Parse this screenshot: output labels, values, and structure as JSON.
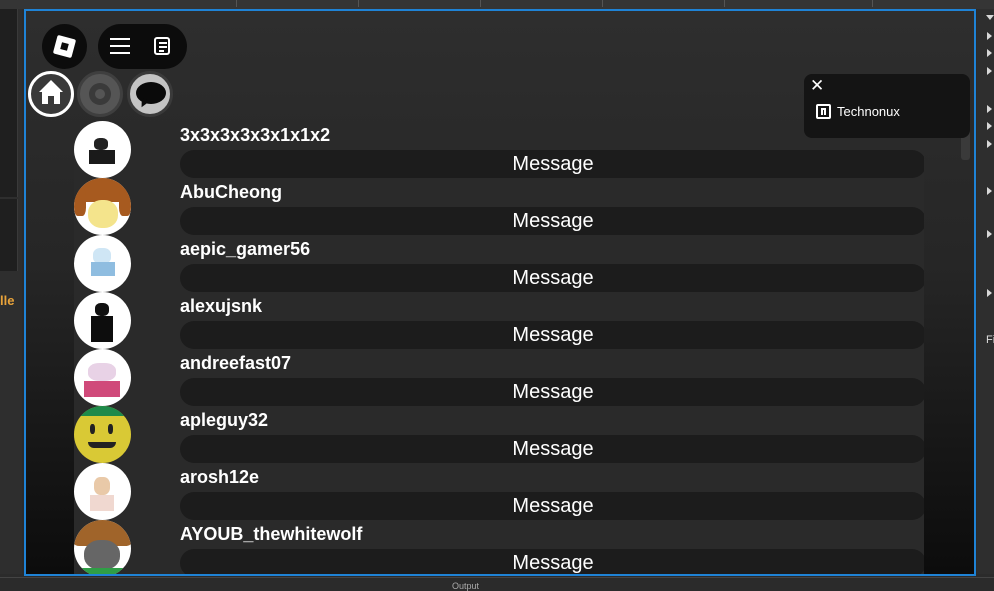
{
  "studio": {
    "left_label_fragment": "lle",
    "right_label_fragment": "Fi",
    "bottom_label_fragment": "Output"
  },
  "topbar": {
    "logo_icon": "roblox-logo-icon",
    "menu_icon": "hamburger-menu-icon",
    "chat_icon": "chat-document-icon"
  },
  "nav": {
    "home_icon": "home-icon",
    "settings_icon": "gear-icon",
    "chat_icon": "speech-bubble-icon"
  },
  "notification": {
    "close_glyph": "✕",
    "name": "Technonux"
  },
  "friends": [
    {
      "username": "3x3x3x3x3x1x1x2",
      "button": "Message"
    },
    {
      "username": "AbuCheong",
      "button": "Message"
    },
    {
      "username": "aepic_gamer56",
      "button": "Message"
    },
    {
      "username": "alexujsnk",
      "button": "Message"
    },
    {
      "username": "andreefast07",
      "button": "Message"
    },
    {
      "username": "apleguy32",
      "button": "Message"
    },
    {
      "username": "arosh12e",
      "button": "Message"
    },
    {
      "username": "AYOUB_thewhitewolf",
      "button": "Message"
    }
  ],
  "colors": {
    "viewport_border": "#1f83d6",
    "accent_warning": "#e8a33a"
  }
}
